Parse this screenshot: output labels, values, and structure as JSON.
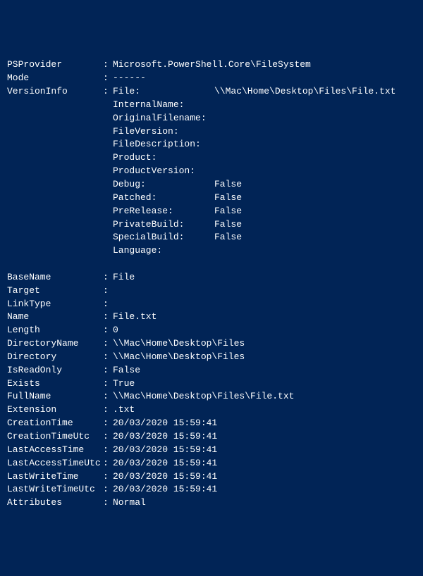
{
  "sep": ":",
  "top": [
    {
      "key": "PSProvider",
      "value": "Microsoft.PowerShell.Core\\FileSystem"
    },
    {
      "key": "Mode",
      "value": "------"
    }
  ],
  "versionInfo": {
    "key": "VersionInfo",
    "firstSub": {
      "key": "File:",
      "value": "\\\\Mac\\Home\\Desktop\\Files\\File.txt"
    },
    "subs": [
      {
        "key": "InternalName:",
        "value": ""
      },
      {
        "key": "OriginalFilename:",
        "value": ""
      },
      {
        "key": "FileVersion:",
        "value": ""
      },
      {
        "key": "FileDescription:",
        "value": ""
      },
      {
        "key": "Product:",
        "value": ""
      },
      {
        "key": "ProductVersion:",
        "value": ""
      },
      {
        "key": "Debug:",
        "value": "False"
      },
      {
        "key": "Patched:",
        "value": "False"
      },
      {
        "key": "PreRelease:",
        "value": "False"
      },
      {
        "key": "PrivateBuild:",
        "value": "False"
      },
      {
        "key": "SpecialBuild:",
        "value": "False"
      },
      {
        "key": "Language:",
        "value": ""
      }
    ]
  },
  "bottom": [
    {
      "key": "BaseName",
      "value": "File"
    },
    {
      "key": "Target",
      "value": ""
    },
    {
      "key": "LinkType",
      "value": ""
    },
    {
      "key": "Name",
      "value": "File.txt"
    },
    {
      "key": "Length",
      "value": "0"
    },
    {
      "key": "DirectoryName",
      "value": "\\\\Mac\\Home\\Desktop\\Files"
    },
    {
      "key": "Directory",
      "value": "\\\\Mac\\Home\\Desktop\\Files"
    },
    {
      "key": "IsReadOnly",
      "value": "False"
    },
    {
      "key": "Exists",
      "value": "True"
    },
    {
      "key": "FullName",
      "value": "\\\\Mac\\Home\\Desktop\\Files\\File.txt"
    },
    {
      "key": "Extension",
      "value": ".txt"
    },
    {
      "key": "CreationTime",
      "value": "20/03/2020 15:59:41"
    },
    {
      "key": "CreationTimeUtc",
      "value": "20/03/2020 15:59:41"
    },
    {
      "key": "LastAccessTime",
      "value": "20/03/2020 15:59:41"
    },
    {
      "key": "LastAccessTimeUtc",
      "value": "20/03/2020 15:59:41"
    },
    {
      "key": "LastWriteTime",
      "value": "20/03/2020 15:59:41"
    },
    {
      "key": "LastWriteTimeUtc",
      "value": "20/03/2020 15:59:41"
    },
    {
      "key": "Attributes",
      "value": "Normal"
    }
  ]
}
